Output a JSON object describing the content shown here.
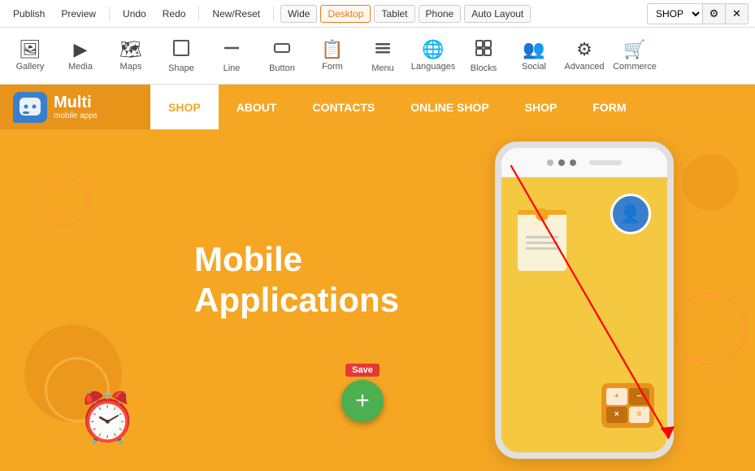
{
  "topbar": {
    "publish_label": "Publish",
    "preview_label": "Preview",
    "undo_label": "Undo",
    "redo_label": "Redo",
    "newreset_label": "New/Reset",
    "view_wide": "Wide",
    "view_desktop": "Desktop",
    "view_tablet": "Tablet",
    "view_phone": "Phone",
    "view_autolayout": "Auto Layout",
    "shop_select_value": "SHOP",
    "gear_icon": "⚙",
    "close_icon": "✕"
  },
  "toolbar": {
    "items": [
      {
        "id": "gallery",
        "icon": "🖼",
        "label": "Gallery"
      },
      {
        "id": "media",
        "icon": "▶",
        "label": "Media"
      },
      {
        "id": "maps",
        "icon": "🗺",
        "label": "Maps"
      },
      {
        "id": "shape",
        "icon": "⬜",
        "label": "Shape"
      },
      {
        "id": "line",
        "icon": "—",
        "label": "Line"
      },
      {
        "id": "button",
        "icon": "⬛",
        "label": "Button"
      },
      {
        "id": "form",
        "icon": "📋",
        "label": "Form"
      },
      {
        "id": "menu",
        "icon": "☰",
        "label": "Menu"
      },
      {
        "id": "languages",
        "icon": "🌐",
        "label": "Languages"
      },
      {
        "id": "blocks",
        "icon": "⊞",
        "label": "Blocks"
      },
      {
        "id": "social",
        "icon": "👥",
        "label": "Social"
      },
      {
        "id": "advanced",
        "icon": "⚙",
        "label": "Advanced"
      },
      {
        "id": "commerce",
        "icon": "🛒",
        "label": "Commerce"
      }
    ]
  },
  "site": {
    "logo_main": "Multi",
    "logo_sub": "mobile apps",
    "nav_items": [
      {
        "id": "shop",
        "label": "SHOP",
        "active": true
      },
      {
        "id": "about",
        "label": "ABOUT"
      },
      {
        "id": "contacts",
        "label": "CONTACTS"
      },
      {
        "id": "online-shop",
        "label": "ONLINE SHOP"
      },
      {
        "id": "shop2",
        "label": "SHOP"
      },
      {
        "id": "form",
        "label": "FORM"
      }
    ],
    "hero_title_line1": "Mobile",
    "hero_title_line2": "Applications",
    "save_label": "Save",
    "add_icon": "+"
  }
}
